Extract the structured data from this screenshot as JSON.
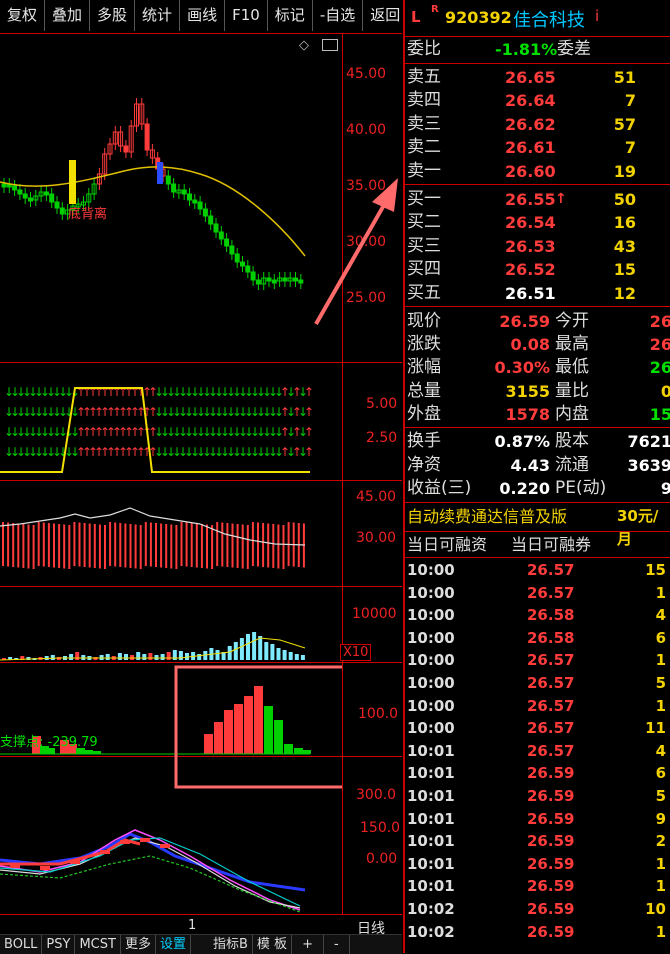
{
  "toolbar": {
    "items": [
      "复权",
      "叠加",
      "多股",
      "统计",
      "画线",
      "F10",
      "标记",
      "-自选",
      "返回"
    ]
  },
  "chart": {
    "price_ticks": [
      "45.00",
      "40.00",
      "35.00",
      "30.00",
      "25.00"
    ],
    "signal_ticks": [
      "5.00",
      "2.50"
    ],
    "ind2_ticks": [
      "45.00",
      "30.00"
    ],
    "volume_tick": "10000",
    "volume_multiplier": "X10",
    "bar_tick": "100.0",
    "support_label": "支撑点: -239.79",
    "macd_ticks": [
      "300.0",
      "150.0",
      "0.00"
    ],
    "annotation": "底背离",
    "period_label": "日线",
    "cursor_label": "1"
  },
  "bottom_tabs": [
    "BOLL",
    "PSY",
    "MCST",
    "更多",
    "设置",
    "指标B",
    "模 板",
    "+",
    "-"
  ],
  "panel": {
    "header": {
      "prefix": "L",
      "badge": "R",
      "code": "920392",
      "name": "佳合科技",
      "info_icon": "i"
    },
    "weibi": {
      "label": "委比",
      "value": "-1.81%",
      "label2": "委差"
    },
    "asks": [
      {
        "label": "卖五",
        "price": "26.65",
        "vol": "51"
      },
      {
        "label": "卖四",
        "price": "26.64",
        "vol": "7"
      },
      {
        "label": "卖三",
        "price": "26.62",
        "vol": "57"
      },
      {
        "label": "卖二",
        "price": "26.61",
        "vol": "7"
      },
      {
        "label": "卖一",
        "price": "26.60",
        "vol": "19"
      }
    ],
    "bids": [
      {
        "label": "买一",
        "price": "26.55",
        "vol": "50",
        "arrow": "↑"
      },
      {
        "label": "买二",
        "price": "26.54",
        "vol": "16"
      },
      {
        "label": "买三",
        "price": "26.53",
        "vol": "43"
      },
      {
        "label": "买四",
        "price": "26.52",
        "vol": "15"
      },
      {
        "label": "买五",
        "price": "26.51",
        "vol": "12"
      }
    ],
    "stats": [
      {
        "l1": "现价",
        "v1": "26.59",
        "l2": "今开",
        "v2": "26"
      },
      {
        "l1": "涨跌",
        "v1": "0.08",
        "l2": "最高",
        "v2": "26"
      },
      {
        "l1": "涨幅",
        "v1": "0.30%",
        "l2": "最低",
        "v2": "26"
      },
      {
        "l1": "总量",
        "v1": "3155",
        "l2": "量比",
        "v2": "0"
      },
      {
        "l1": "外盘",
        "v1": "1578",
        "l2": "内盘",
        "v2": "15"
      }
    ],
    "stats2": [
      {
        "l1": "换手",
        "v1": "0.87%",
        "l2": "股本",
        "v2": "7621"
      },
      {
        "l1": "净资",
        "v1": "4.43",
        "l2": "流通",
        "v2": "3639"
      },
      {
        "l1": "收益(三)",
        "v1": "0.220",
        "l2": "PE(动)",
        "v2": "9"
      }
    ],
    "promo": {
      "text": "自动续费通达信普及版",
      "price": "30元/月"
    },
    "margin": {
      "left": "当日可融资",
      "right": "当日可融券"
    },
    "ticks": [
      {
        "t": "10:00",
        "p": "26.57",
        "v": "15"
      },
      {
        "t": "10:00",
        "p": "26.57",
        "v": "1"
      },
      {
        "t": "10:00",
        "p": "26.58",
        "v": "4"
      },
      {
        "t": "10:00",
        "p": "26.58",
        "v": "6"
      },
      {
        "t": "10:00",
        "p": "26.57",
        "v": "1"
      },
      {
        "t": "10:00",
        "p": "26.57",
        "v": "5"
      },
      {
        "t": "10:00",
        "p": "26.57",
        "v": "1"
      },
      {
        "t": "10:00",
        "p": "26.57",
        "v": "11"
      },
      {
        "t": "10:01",
        "p": "26.57",
        "v": "4"
      },
      {
        "t": "10:01",
        "p": "26.59",
        "v": "6"
      },
      {
        "t": "10:01",
        "p": "26.59",
        "v": "5"
      },
      {
        "t": "10:01",
        "p": "26.59",
        "v": "9"
      },
      {
        "t": "10:01",
        "p": "26.59",
        "v": "2"
      },
      {
        "t": "10:01",
        "p": "26.59",
        "v": "1"
      },
      {
        "t": "10:01",
        "p": "26.59",
        "v": "1"
      },
      {
        "t": "10:02",
        "p": "26.59",
        "v": "10"
      },
      {
        "t": "10:02",
        "p": "26.59",
        "v": "1"
      }
    ]
  },
  "colors": {
    "up": "#ff3b3b",
    "down": "#00d000",
    "accent": "#c00000",
    "yellow": "#f2d200",
    "ma": "#e0c000",
    "highlight": "#ff6b6b"
  }
}
